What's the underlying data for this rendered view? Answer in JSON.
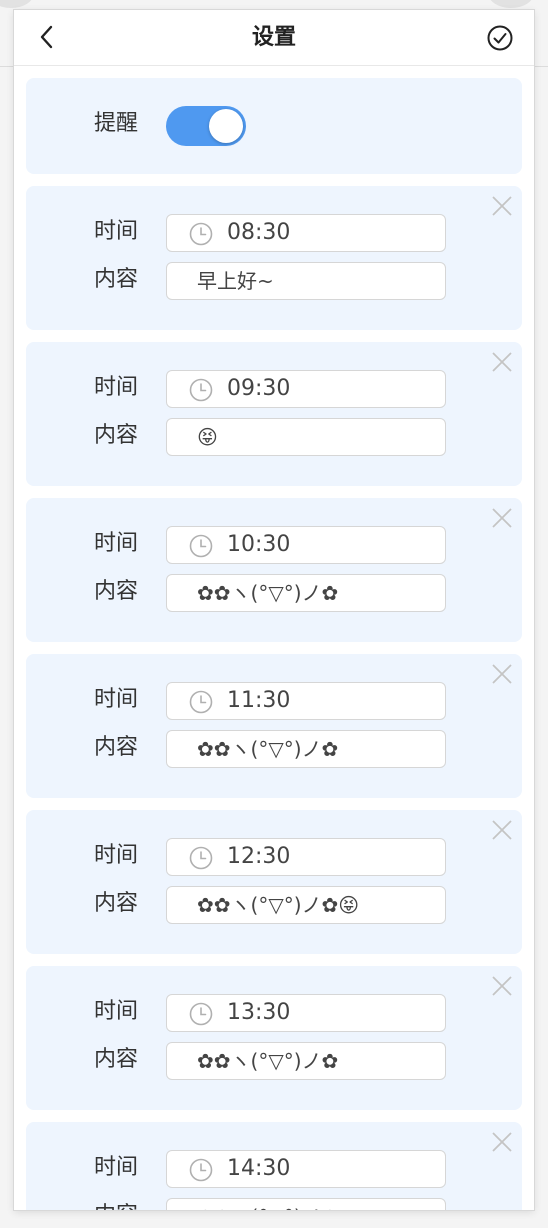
{
  "header": {
    "title": "设置",
    "back_icon": "chevron-left-icon",
    "confirm_icon": "check-circle-icon"
  },
  "reminder": {
    "label": "提醒",
    "enabled": true
  },
  "items": [
    {
      "time_label": "时间",
      "time": "08:30",
      "content_label": "内容",
      "content": "早上好~"
    },
    {
      "time_label": "时间",
      "time": "09:30",
      "content_label": "内容",
      "content": "😝"
    },
    {
      "time_label": "时间",
      "time": "10:30",
      "content_label": "内容",
      "content": "✿✿ヽ(°▽°)ノ✿"
    },
    {
      "time_label": "时间",
      "time": "11:30",
      "content_label": "内容",
      "content": "✿✿ヽ(°▽°)ノ✿"
    },
    {
      "time_label": "时间",
      "time": "12:30",
      "content_label": "内容",
      "content": "✿✿ヽ(°▽°)ノ✿😝"
    },
    {
      "time_label": "时间",
      "time": "13:30",
      "content_label": "内容",
      "content": "✿✿ヽ(°▽°)ノ✿"
    },
    {
      "time_label": "时间",
      "time": "14:30",
      "content_label": "内容",
      "content": "✿✿ヽ(°▽°)ノ✿"
    }
  ],
  "colors": {
    "accent": "#4f99f0",
    "panel_bg": "#eef5fe"
  }
}
